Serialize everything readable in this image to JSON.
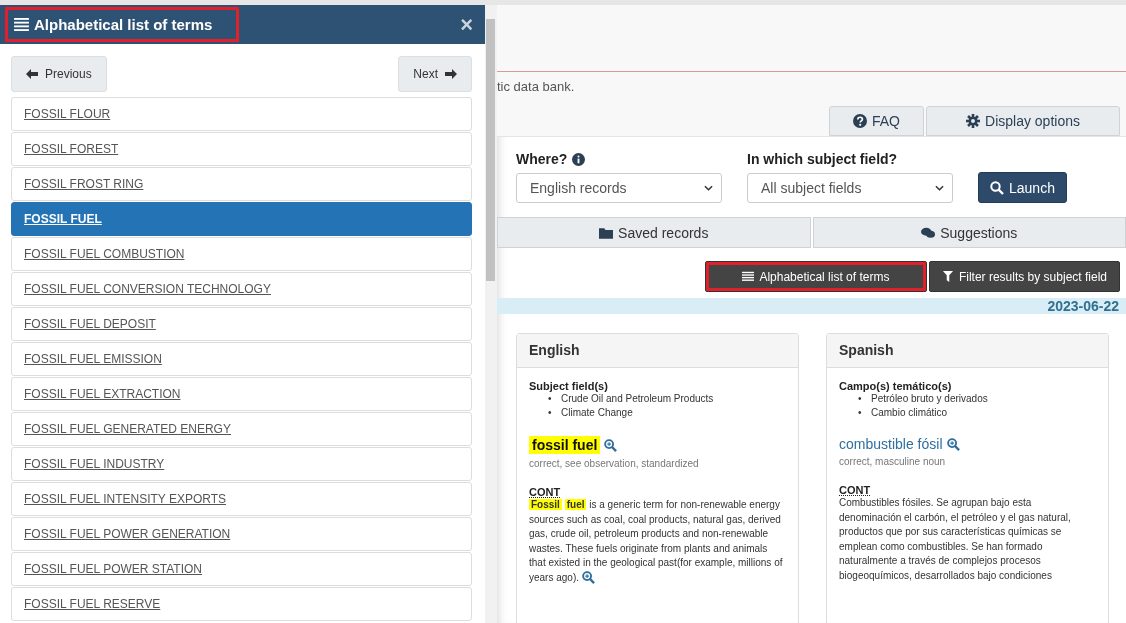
{
  "panel": {
    "title": "Alphabetical list of terms",
    "highlighted": true,
    "close": "×",
    "previous": "Previous",
    "next": "Next",
    "terms": [
      {
        "label": "FOSSIL FLOUR",
        "selected": false
      },
      {
        "label": "FOSSIL FOREST",
        "selected": false
      },
      {
        "label": "FOSSIL FROST RING",
        "selected": false
      },
      {
        "label": "FOSSIL FUEL",
        "selected": true
      },
      {
        "label": "FOSSIL FUEL COMBUSTION",
        "selected": false
      },
      {
        "label": "FOSSIL FUEL CONVERSION TECHNOLOGY",
        "selected": false
      },
      {
        "label": "FOSSIL FUEL DEPOSIT",
        "selected": false
      },
      {
        "label": "FOSSIL FUEL EMISSION",
        "selected": false
      },
      {
        "label": "FOSSIL FUEL EXTRACTION",
        "selected": false
      },
      {
        "label": "FOSSIL FUEL GENERATED ENERGY",
        "selected": false
      },
      {
        "label": "FOSSIL FUEL INDUSTRY",
        "selected": false
      },
      {
        "label": "FOSSIL FUEL INTENSITY EXPORTS",
        "selected": false
      },
      {
        "label": "FOSSIL FUEL POWER GENERATION",
        "selected": false
      },
      {
        "label": "FOSSIL FUEL POWER STATION",
        "selected": false
      },
      {
        "label": "FOSSIL FUEL RESERVE",
        "selected": false
      }
    ]
  },
  "intro": "tic data bank.",
  "top_buttons": [
    "FAQ",
    "Display options"
  ],
  "search": {
    "where_label": "Where?",
    "where_value": "English records",
    "field_label": "In which subject field?",
    "field_value": "All subject fields",
    "launch": "Launch"
  },
  "tabs": [
    {
      "label": "Saved records",
      "kind": "folder"
    },
    {
      "label": "Suggestions",
      "kind": "comments"
    }
  ],
  "tools": [
    {
      "label": "Alphabetical list of terms",
      "kind": "list",
      "highlighted": true
    },
    {
      "label": "Filter results by subject field",
      "kind": "filter",
      "highlighted": false
    }
  ],
  "date": "2023-06-22",
  "records": [
    {
      "language": "English",
      "bullet": "•",
      "fields_label": "Subject field(s)",
      "fields": [
        "Crude Oil and Petroleum Products",
        "Climate Change"
      ],
      "term": "fossil fuel",
      "term_highlighted": true,
      "term_info": "correct, see observation, standardized",
      "section": "CONT",
      "definition": [
        {
          "text": "Fossil",
          "highlight": true
        },
        {
          "text": "fuel",
          "highlight": true
        },
        {
          "text": "is a generic term for non-renewable energy sources such as coal, coal products, natural gas, derived gas, crude oil, petroleum products and non-renewable wastes. These fuels originate from plants and animals that existed in the geological past(for example, millions of years ago).",
          "highlight": false
        }
      ],
      "definition_link": true
    },
    {
      "language": "Spanish",
      "bullet": "•",
      "fields_label": "Campo(s) temático(s)",
      "fields": [
        "Petróleo bruto y derivados",
        "Cambio climático"
      ],
      "term": "combustible fósil",
      "term_highlighted": false,
      "term_info": "correct, masculine noun",
      "section": "CONT",
      "definition": [
        {
          "text": "Combustibles fósiles. Se agrupan bajo esta denominación el carbón, el petróleo y el gas natural, productos que por sus características químicas se emplean como combustibles. Se han formado naturalmente a través de complejos procesos biogeoquímicos, desarrollados bajo condiciones",
          "highlight": false
        }
      ]
    }
  ]
}
